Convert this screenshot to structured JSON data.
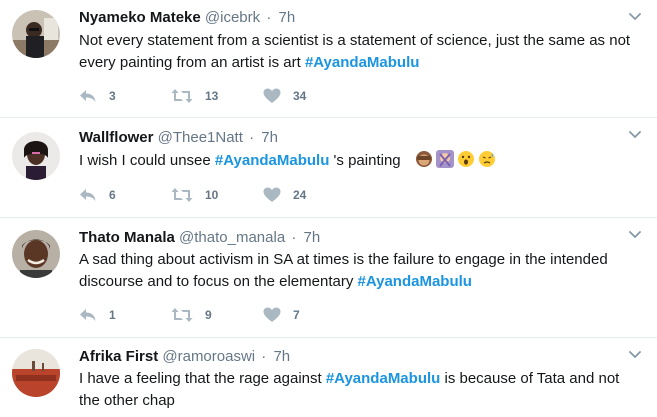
{
  "tweets": [
    {
      "name": "Nyameko Mateke",
      "handle": "@icebrk",
      "time": "7h",
      "text_before": "Not every statement from a scientist is a statement of science, just the same as not every painting from an artist is art ",
      "hashtag": "#AyandaMabulu",
      "text_after": "",
      "replies": "3",
      "retweets": "13",
      "likes": "34"
    },
    {
      "name": "Wallflower",
      "handle": "@Thee1Natt",
      "time": "7h",
      "text_before": "I wish I could unsee ",
      "hashtag": "#AyandaMabulu",
      "text_after": " 's painting",
      "emojis": [
        "see-no-evil-monkey-emoji",
        "woman-gesturing-no-emoji",
        "astonished-face-emoji",
        "disappointed-relieved-face-emoji"
      ],
      "replies": "6",
      "retweets": "10",
      "likes": "24"
    },
    {
      "name": "Thato Manala",
      "handle": "@thato_manala",
      "time": "7h",
      "text_before": "A sad thing about activism in SA at times is the failure to engage in the intended discourse and to focus on the elementary ",
      "hashtag": "#AyandaMabulu",
      "text_after": "",
      "replies": "1",
      "retweets": "9",
      "likes": "7"
    },
    {
      "name": "Afrika First",
      "handle": "@ramoroaswi",
      "time": "7h",
      "text_before": "I have a feeling that the rage against ",
      "hashtag": "#AyandaMabulu",
      "text_after": " is because of Tata and not the other chap"
    }
  ],
  "separator": "·",
  "colors": {
    "hashtag": "#1b95e0",
    "meta": "#657786",
    "text": "#14171a",
    "divider": "#e6ecf0"
  }
}
